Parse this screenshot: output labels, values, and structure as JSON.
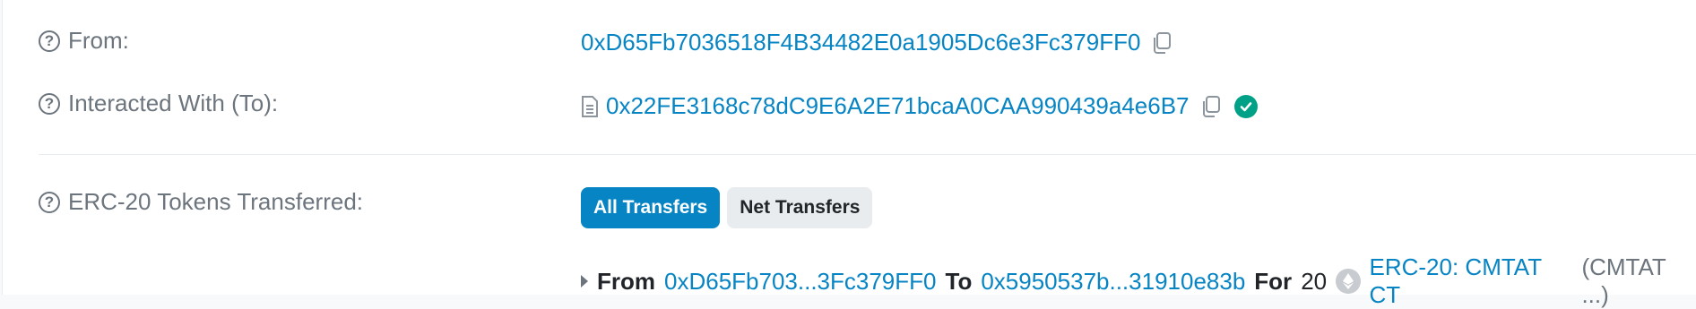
{
  "rows": {
    "from": {
      "label": "From:",
      "address": "0xD65Fb7036518F4B34482E0a1905Dc6e3Fc379FF0"
    },
    "interacted": {
      "label": "Interacted With (To):",
      "address": "0x22FE3168c78dC9E6A2E71bcaA0CAA990439a4e6B7"
    },
    "tokens": {
      "label": "ERC-20 Tokens Transferred:",
      "tabs": [
        "All Transfers",
        "Net Transfers"
      ],
      "transfer": {
        "from_kw": "From",
        "from_addr": "0xD65Fb703...3Fc379FF0",
        "to_kw": "To",
        "to_addr": "0x5950537b...31910e83b",
        "for_kw": "For",
        "amount": "20",
        "token_name": "ERC-20: CMTAT CT",
        "token_symbol": "(CMTAT ...)"
      }
    }
  },
  "colors": {
    "link": "#0784c3",
    "verified": "#00a186",
    "active_tab": "#0784c3"
  },
  "icons": {
    "help": "question-circle-icon",
    "copy": "copy-icon",
    "contract": "file-contract-icon",
    "verified": "check-circle-icon",
    "expand": "caret-right-icon",
    "token": "ethereum-token-icon"
  }
}
